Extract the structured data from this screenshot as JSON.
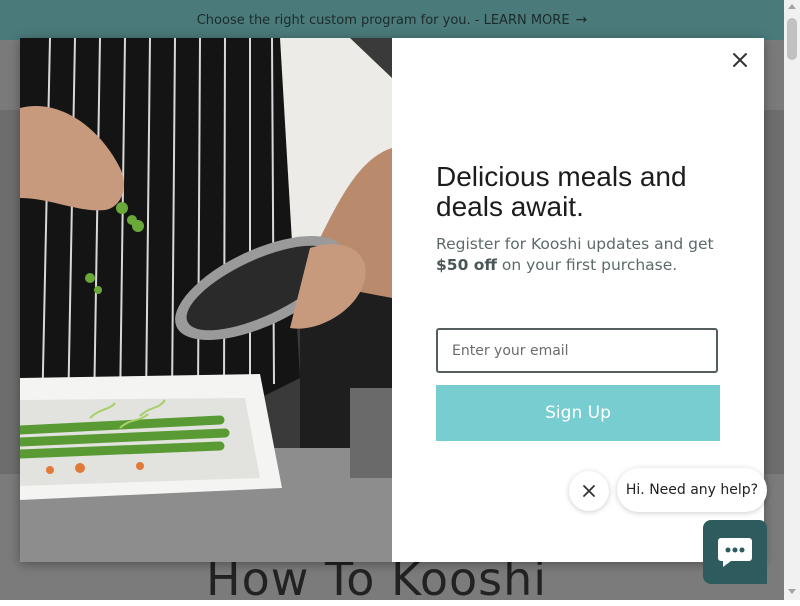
{
  "announcement": {
    "text": "Choose the right custom program for you. - LEARN MORE",
    "arrow_icon": "arrow-right-icon"
  },
  "page": {
    "heading": "How To Kooshi"
  },
  "modal": {
    "close_icon": "close-icon",
    "headline": "Delicious meals and deals await.",
    "sub_before": "Register for Kooshi updates and get ",
    "sub_bold": "$50 off",
    "sub_after": " on your first purchase.",
    "email_placeholder": "Enter your email",
    "email_value": "",
    "signup_label": "Sign Up",
    "image_icon": "chef-plating-photo"
  },
  "chat": {
    "greeting": "Hi. Need any help?",
    "dismiss_icon": "close-icon",
    "launcher_icon": "chat-icon"
  },
  "colors": {
    "announce_bg": "#4a7a7a",
    "signup_bg": "#78cdd0",
    "chat_launcher": "#2d5b5e"
  }
}
